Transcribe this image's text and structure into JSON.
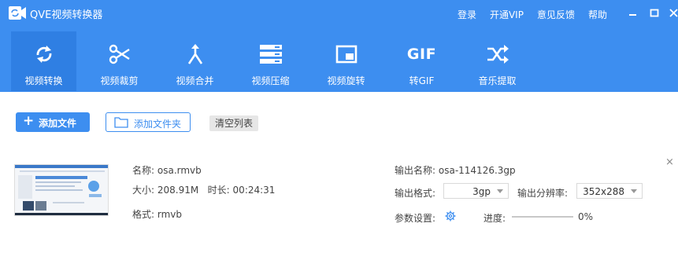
{
  "app": {
    "title": "QVE视频转换器"
  },
  "top_links": [
    "登录",
    "开通VIP",
    "意见反馈",
    "帮助"
  ],
  "tabs": [
    {
      "label": "视频转换",
      "icon": "refresh-icon",
      "active": true
    },
    {
      "label": "视频裁剪",
      "icon": "scissors-icon",
      "active": false
    },
    {
      "label": "视频合并",
      "icon": "merge-icon",
      "active": false
    },
    {
      "label": "视频压缩",
      "icon": "compress-icon",
      "active": false
    },
    {
      "label": "视频旋转",
      "icon": "rotate-icon",
      "active": false
    },
    {
      "label": "转GIF",
      "icon": "gif-icon",
      "active": false
    },
    {
      "label": "音乐提取",
      "icon": "shuffle-icon",
      "active": false
    }
  ],
  "gif_icon_text": "GIF",
  "toolbar": {
    "add_file": "添加文件",
    "add_folder": "添加文件夹",
    "clear_list": "清空列表"
  },
  "file": {
    "name_label": "名称:",
    "name": "osa.rmvb",
    "size_label": "大小:",
    "size": "208.91M",
    "duration_label": "时长:",
    "duration": "00:24:31",
    "format_label": "格式:",
    "format": "rmvb",
    "output_name_label": "输出名称:",
    "output_name": "osa-114126.3gp",
    "output_format_label": "输出格式:",
    "output_format": "3gp",
    "output_res_label": "输出分辨率:",
    "output_res": "352x288",
    "param_label": "参数设置:",
    "progress_label": "进度:",
    "progress": 0,
    "progress_text": "0%"
  },
  "colors": {
    "brand": "#3d8ef0",
    "active_tab": "#2f7fe3"
  }
}
